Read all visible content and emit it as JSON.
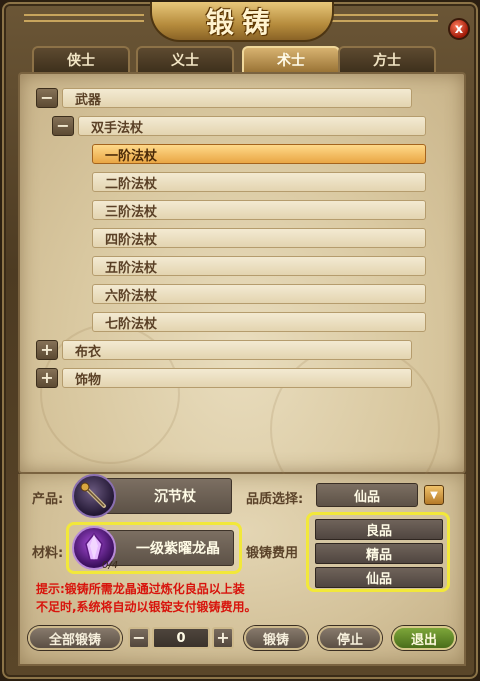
{
  "window": {
    "title": "锻铸",
    "close_label": "x"
  },
  "tabs": [
    {
      "label": "侠士",
      "active": false
    },
    {
      "label": "义士",
      "active": false
    },
    {
      "label": "术士",
      "active": true
    },
    {
      "label": "方士",
      "active": false
    }
  ],
  "tree": {
    "category_weapon": {
      "label": "武器",
      "toggle": "−"
    },
    "sub_staff": {
      "label": "双手法杖",
      "toggle": "−"
    },
    "tiers": [
      {
        "label": "一阶法杖",
        "selected": true
      },
      {
        "label": "二阶法杖",
        "selected": false
      },
      {
        "label": "三阶法杖",
        "selected": false
      },
      {
        "label": "四阶法杖",
        "selected": false
      },
      {
        "label": "五阶法杖",
        "selected": false
      },
      {
        "label": "六阶法杖",
        "selected": false
      },
      {
        "label": "七阶法杖",
        "selected": false
      }
    ],
    "category_cloth": {
      "label": "布衣",
      "toggle": "+"
    },
    "category_accessory": {
      "label": "饰物",
      "toggle": "+"
    }
  },
  "product": {
    "label": "产品:",
    "name": "沉节杖"
  },
  "material": {
    "label": "材料:",
    "name": "一级紫曜龙晶",
    "count": "0/4"
  },
  "quality": {
    "label": "品质选择:",
    "selected": "仙品",
    "options": [
      "良品",
      "精品",
      "仙品"
    ]
  },
  "cost": {
    "label": "锻铸费用"
  },
  "hint": {
    "line1": "提示:锻铸所需龙晶通过炼化良品以上装",
    "line2": "不足时,系统将自动以银锭支付锻铸费用。"
  },
  "footer": {
    "forge_all": "全部锻铸",
    "minus": "−",
    "quantity": "0",
    "plus": "+",
    "forge": "锻铸",
    "stop": "停止",
    "exit": "退出"
  },
  "colors": {
    "hint": "#d8140c",
    "highlight": "#f2e83a",
    "selected_row": "#e9a644"
  }
}
